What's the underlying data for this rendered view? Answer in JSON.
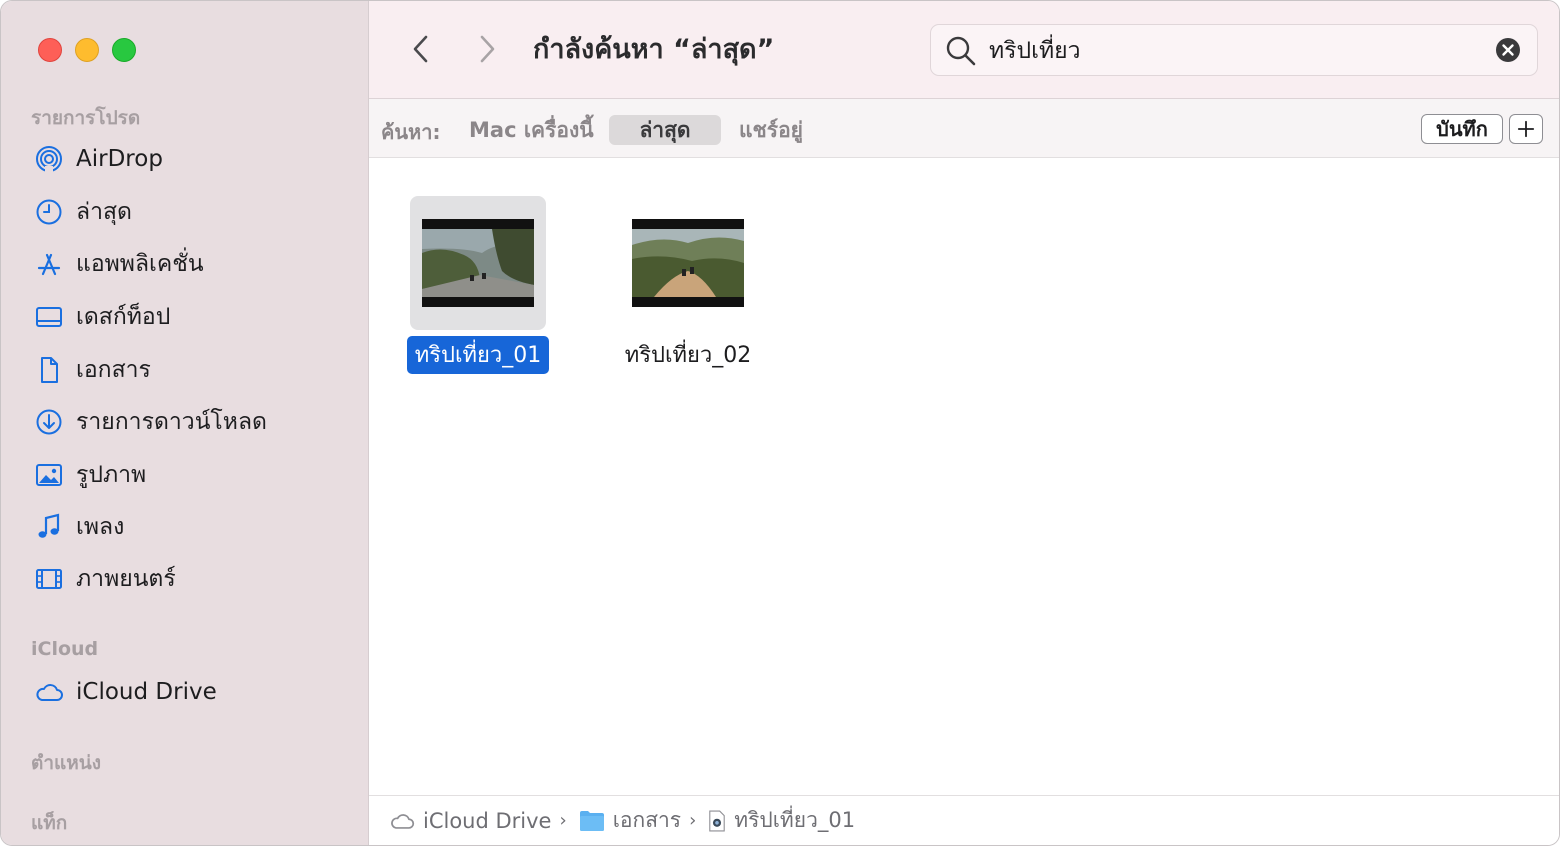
{
  "window": {
    "title": "กำลังค้นหา “ล่าสุด”"
  },
  "sidebar": {
    "favorites_title": "รายการโปรด",
    "items": [
      {
        "label": "AirDrop",
        "icon": "airdrop-icon"
      },
      {
        "label": "ล่าสุด",
        "icon": "clock-icon"
      },
      {
        "label": "แอพพลิเคชั่น",
        "icon": "applications-icon"
      },
      {
        "label": "เดสก์ท็อป",
        "icon": "desktop-icon"
      },
      {
        "label": "เอกสาร",
        "icon": "document-icon"
      },
      {
        "label": "รายการดาวน์โหลด",
        "icon": "download-icon"
      },
      {
        "label": "รูปภาพ",
        "icon": "photo-icon"
      },
      {
        "label": "เพลง",
        "icon": "music-icon"
      },
      {
        "label": "ภาพยนตร์",
        "icon": "film-icon"
      }
    ],
    "icloud_title": "iCloud",
    "icloud_items": [
      {
        "label": "iCloud Drive",
        "icon": "cloud-icon"
      }
    ],
    "locations_title": "ตำแหน่ง",
    "tags_title": "แท็ก"
  },
  "search": {
    "value": "ทริปเที่ยว"
  },
  "scopebar": {
    "label": "ค้นหา:",
    "options": [
      "Mac เครื่องนี้",
      "ล่าสุด",
      "แชร์อยู่"
    ],
    "active": "ล่าสุด",
    "save_label": "บันทึก"
  },
  "files": [
    {
      "name": "ทริปเที่ยว_01",
      "selected": true
    },
    {
      "name": "ทริปเที่ยว_02",
      "selected": false
    }
  ],
  "pathbar": {
    "segments": [
      "iCloud Drive",
      "เอกสาร",
      "ทริปเที่ยว_01"
    ]
  },
  "colors": {
    "sidebar_bg": "#e8dde0",
    "titlebar_bg": "#f9eef1",
    "selection": "#1766d8",
    "accent_icon": "#1a6fe0"
  }
}
